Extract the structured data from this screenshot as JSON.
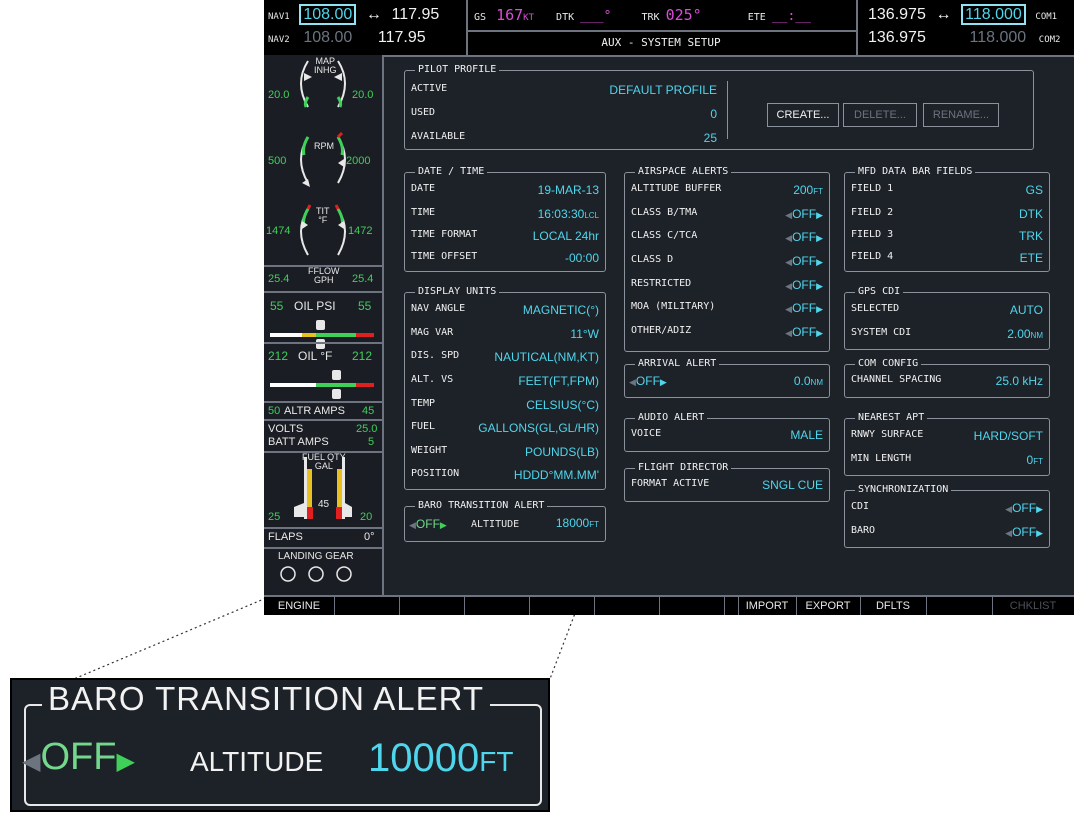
{
  "nav": {
    "nav1_label": "NAV1",
    "nav1_active": "108.00",
    "nav1_arrow": "↔",
    "nav1_standby": "117.95",
    "nav2_label": "NAV2",
    "nav2_active": "108.00",
    "nav2_standby": "117.95"
  },
  "status": {
    "gs_label": "GS",
    "gs_value": "167",
    "gs_unit": "KT",
    "dtk_label": "DTK",
    "dtk_value": "___°",
    "trk_label": "TRK",
    "trk_value": "025°",
    "ete_label": "ETE",
    "ete_value": "__:__",
    "page_title": "AUX - SYSTEM SETUP"
  },
  "com": {
    "com1_active": "136.975",
    "com1_arrow": "↔",
    "com1_standby": "118.000",
    "com1_label": "COM1",
    "com2_active": "136.975",
    "com2_standby": "118.000",
    "com2_label": "COM2"
  },
  "eis": {
    "map_label": "MAP",
    "map_unit": "INHG",
    "map_left": "20.0",
    "map_right": "20.0",
    "rpm_label": "RPM",
    "rpm_left": "500",
    "rpm_right": "2000",
    "tit_label": "TIT",
    "tit_unit": "°F",
    "tit_left": "1474",
    "tit_right": "1472",
    "fflow_label": "FFLOW",
    "fflow_unit": "GPH",
    "fflow_left": "25.4",
    "fflow_right": "25.4",
    "oilpsi_label": "OIL PSI",
    "oilpsi_left": "55",
    "oilpsi_right": "55",
    "oiltemp_label": "OIL °F",
    "oiltemp_left": "212",
    "oiltemp_right": "212",
    "altr_label": "ALTR AMPS",
    "altr_left": "50",
    "altr_right": "45",
    "volts_label": "VOLTS",
    "volts_value": "25.0",
    "batt_label": "BATT AMPS",
    "batt_value": "5",
    "fuel_label": "FUEL QTY",
    "fuel_unit": "GAL",
    "fuel_left": "25",
    "fuel_mid": "45",
    "fuel_right": "20",
    "flaps_label": "FLAPS",
    "flaps_value": "0°",
    "gear_label": "LANDING GEAR"
  },
  "pilot_profile": {
    "title": "PILOT PROFILE",
    "active_label": "ACTIVE",
    "active_value": "DEFAULT PROFILE",
    "used_label": "USED",
    "used_value": "0",
    "available_label": "AVAILABLE",
    "available_value": "25",
    "create_button": "CREATE...",
    "delete_button": "DELETE...",
    "rename_button": "RENAME..."
  },
  "date_time": {
    "title": "DATE / TIME",
    "rows": [
      {
        "label": "DATE",
        "value": "19-MAR-13",
        "unit": ""
      },
      {
        "label": "TIME",
        "value": "16:03:30",
        "unit": "LCL"
      },
      {
        "label": "TIME FORMAT",
        "value": "LOCAL 24hr",
        "unit": ""
      },
      {
        "label": "TIME OFFSET",
        "value": "-00:00",
        "unit": ""
      }
    ]
  },
  "display_units": {
    "title": "DISPLAY UNITS",
    "rows": [
      {
        "label": "NAV ANGLE",
        "value": "MAGNETIC(°)"
      },
      {
        "label": "MAG VAR",
        "value": "11°W"
      },
      {
        "label": "DIS. SPD",
        "value": "NAUTICAL(NM,KT)"
      },
      {
        "label": "ALT. VS",
        "value": "FEET(FT,FPM)"
      },
      {
        "label": "TEMP",
        "value": "CELSIUS(°C)"
      },
      {
        "label": "FUEL",
        "value": "GALLONS(GL,GL/HR)"
      },
      {
        "label": "WEIGHT",
        "value": "POUNDS(LB)"
      },
      {
        "label": "POSITION",
        "value": "HDDD°MM.MM'"
      }
    ]
  },
  "baro_alert": {
    "title": "BARO TRANSITION ALERT",
    "state": "OFF",
    "altitude_label": "ALTITUDE",
    "altitude_value": "18000",
    "altitude_unit": "FT"
  },
  "airspace_alerts": {
    "title": "AIRSPACE ALERTS",
    "buffer_label": "ALTITUDE BUFFER",
    "buffer_value": "200",
    "buffer_unit": "FT",
    "rows": [
      {
        "label": "CLASS B/TMA",
        "value": "OFF"
      },
      {
        "label": "CLASS C/TCA",
        "value": "OFF"
      },
      {
        "label": "CLASS D",
        "value": "OFF"
      },
      {
        "label": "RESTRICTED",
        "value": "OFF"
      },
      {
        "label": "MOA (MILITARY)",
        "value": "OFF"
      },
      {
        "label": "OTHER/ADIZ",
        "value": "OFF"
      }
    ]
  },
  "arrival_alert": {
    "title": "ARRIVAL ALERT",
    "state": "OFF",
    "distance": "0.0",
    "unit": "NM"
  },
  "audio_alert": {
    "title": "AUDIO ALERT",
    "label": "VOICE",
    "value": "MALE"
  },
  "flight_director": {
    "title": "FLIGHT DIRECTOR",
    "label": "FORMAT ACTIVE",
    "value": "SNGL CUE"
  },
  "mfd_fields": {
    "title": "MFD DATA BAR FIELDS",
    "rows": [
      {
        "label": "FIELD 1",
        "value": "GS"
      },
      {
        "label": "FIELD 2",
        "value": "DTK"
      },
      {
        "label": "FIELD 3",
        "value": "TRK"
      },
      {
        "label": "FIELD 4",
        "value": "ETE"
      }
    ]
  },
  "gps_cdi": {
    "title": "GPS CDI",
    "selected_label": "SELECTED",
    "selected_value": "AUTO",
    "system_label": "SYSTEM CDI",
    "system_value": "2.00",
    "system_unit": "NM"
  },
  "com_config": {
    "title": "COM CONFIG",
    "label": "CHANNEL SPACING",
    "value": "25.0 kHz"
  },
  "nearest_apt": {
    "title": "NEAREST APT",
    "surface_label": "RNWY SURFACE",
    "surface_value": "HARD/SOFT",
    "length_label": "MIN LENGTH",
    "length_value": "0",
    "length_unit": "FT"
  },
  "sync": {
    "title": "SYNCHRONIZATION",
    "rows": [
      {
        "label": "CDI",
        "value": "OFF"
      },
      {
        "label": "BARO",
        "value": "OFF"
      }
    ]
  },
  "softkeys": [
    "ENGINE",
    "",
    "",
    "",
    "",
    "",
    "",
    "",
    "IMPORT",
    "EXPORT",
    "DFLTS",
    "",
    "CHKLIST"
  ],
  "zoom": {
    "title": "BARO TRANSITION ALERT",
    "state": "OFF",
    "altitude_label": "ALTITUDE",
    "altitude_value": "10000",
    "altitude_unit": "FT"
  }
}
